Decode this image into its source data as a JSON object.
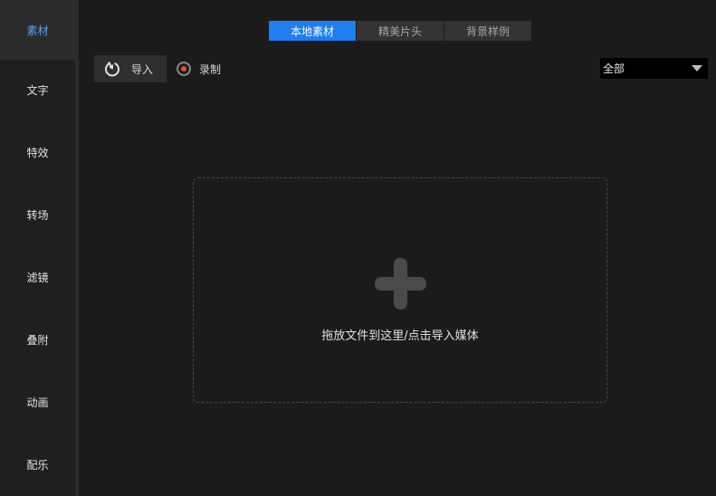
{
  "sidebar": {
    "items": [
      {
        "label": "素材",
        "active": true
      },
      {
        "label": "文字",
        "active": false
      },
      {
        "label": "特效",
        "active": false
      },
      {
        "label": "转场",
        "active": false
      },
      {
        "label": "滤镜",
        "active": false
      },
      {
        "label": "叠附",
        "active": false
      },
      {
        "label": "动画",
        "active": false
      },
      {
        "label": "配乐",
        "active": false
      }
    ]
  },
  "tabs": [
    {
      "label": "本地素材",
      "active": true
    },
    {
      "label": "精美片头",
      "active": false
    },
    {
      "label": "背景样例",
      "active": false
    }
  ],
  "toolbar": {
    "import_label": "导入",
    "import_icon": "import-icon",
    "record_label": "录制",
    "record_color": "#d9551f"
  },
  "filter": {
    "selected": "全部"
  },
  "dropzone": {
    "text": "拖放文件到这里/点击导入媒体",
    "icon": "plus-icon"
  },
  "colors": {
    "accent": "#1e7df0",
    "active_sidebar_text": "#5aa2f0",
    "background": "#1b1b1b"
  }
}
